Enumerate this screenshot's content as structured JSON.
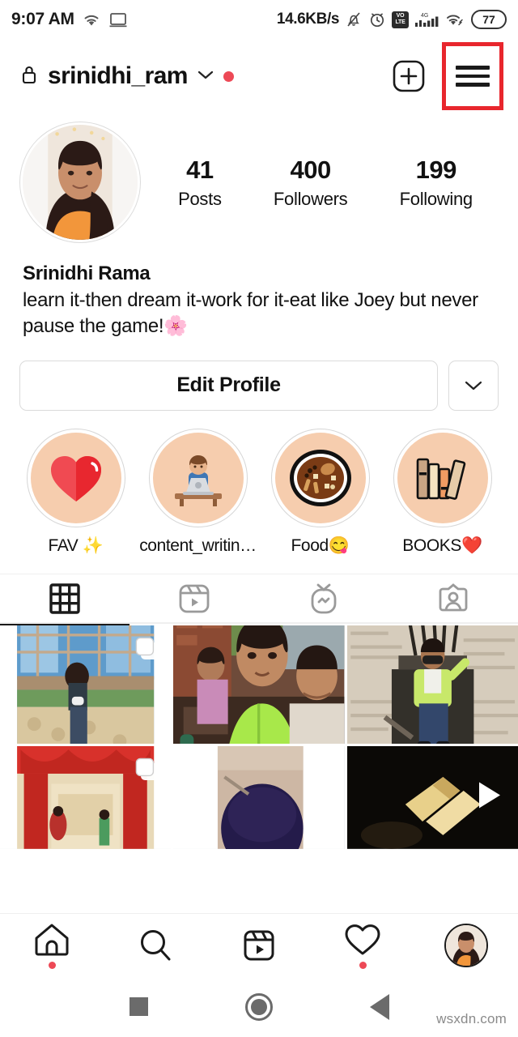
{
  "status_bar": {
    "time": "9:07 AM",
    "network_speed": "14.6KB/s",
    "battery_level": "77",
    "icons": [
      "wifi-icon",
      "cast-screen-icon",
      "bell-muted-icon",
      "alarm-icon",
      "volte-icon",
      "signal-4g-icon",
      "wifi-link-icon",
      "battery-icon"
    ],
    "volte_top": "VO",
    "volte_bottom": "LTE",
    "signal_label": "4G"
  },
  "header": {
    "username": "srinidhi_ram",
    "lock_icon": "lock-icon",
    "chevron_icon": "chevron-down-icon",
    "unread_dot": true,
    "add_label": "add-post-icon",
    "menu_label": "hamburger-menu-icon",
    "highlight_color": "#E8262D"
  },
  "profile": {
    "avatar_alt": "profile-picture",
    "stats": [
      {
        "value": "41",
        "label": "Posts"
      },
      {
        "value": "400",
        "label": "Followers"
      },
      {
        "value": "199",
        "label": "Following"
      }
    ],
    "display_name": "Srinidhi Rama",
    "bio": "learn it-then dream it-work for it-eat like Joey but never pause the game!🌸"
  },
  "actions": {
    "edit_profile_label": "Edit Profile",
    "dropdown_icon": "chevron-down-icon"
  },
  "highlights": [
    {
      "label": "FAV ✨",
      "emoji": "❤️",
      "name": "highlight-fav"
    },
    {
      "label": "content_writin…",
      "emoji": "👨‍💻",
      "name": "highlight-content-writing"
    },
    {
      "label": "Food😋",
      "emoji": "🍲",
      "name": "highlight-food"
    },
    {
      "label": "BOOKS❤️",
      "emoji": "📚",
      "name": "highlight-books"
    }
  ],
  "tabs": [
    {
      "name": "tab-grid",
      "icon": "grid-icon",
      "active": true
    },
    {
      "name": "tab-reels",
      "icon": "reels-icon",
      "active": false
    },
    {
      "name": "tab-igtv",
      "icon": "igtv-icon",
      "active": false
    },
    {
      "name": "tab-tagged",
      "icon": "tagged-person-icon",
      "active": false
    }
  ],
  "grid_posts": [
    {
      "name": "post-1",
      "type": "carousel",
      "badge": "carousel-icon"
    },
    {
      "name": "post-2",
      "type": "photo",
      "badge": ""
    },
    {
      "name": "post-3",
      "type": "photo",
      "badge": ""
    },
    {
      "name": "post-4",
      "type": "carousel",
      "badge": "carousel-icon"
    },
    {
      "name": "post-5",
      "type": "photo",
      "badge": ""
    },
    {
      "name": "post-6",
      "type": "video",
      "badge": "play-icon"
    }
  ],
  "bottom_nav": [
    {
      "name": "nav-home",
      "icon": "home-icon",
      "dot": true
    },
    {
      "name": "nav-search",
      "icon": "search-icon",
      "dot": false
    },
    {
      "name": "nav-reels",
      "icon": "reels-icon",
      "dot": false
    },
    {
      "name": "nav-activity",
      "icon": "heart-icon",
      "dot": true
    },
    {
      "name": "nav-profile",
      "icon": "profile-avatar-icon",
      "dot": false
    }
  ],
  "system_nav": {
    "recents": "recents-square-icon",
    "home": "home-circle-icon",
    "back": "back-triangle-icon"
  },
  "watermark": "wsxdn.com"
}
